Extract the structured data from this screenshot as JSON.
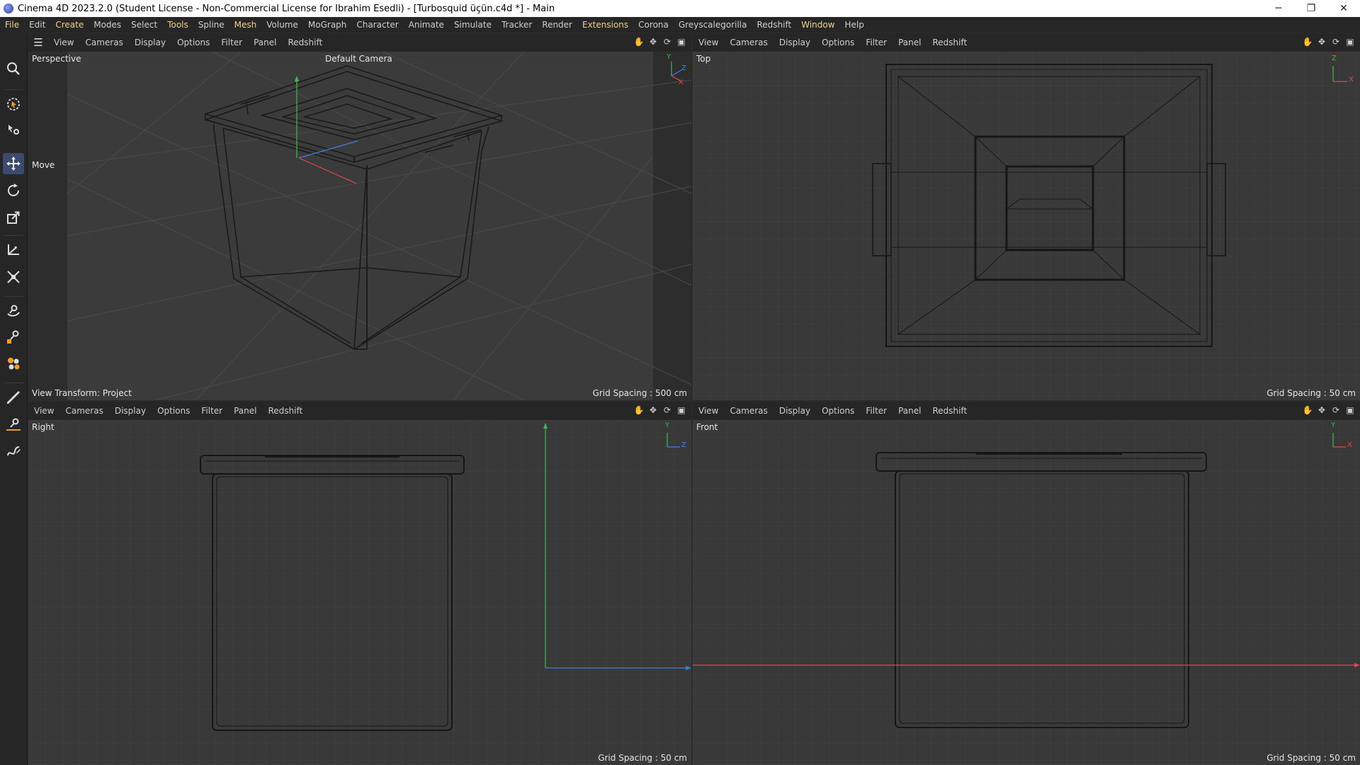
{
  "window": {
    "title": "Cinema 4D 2023.2.0 (Student License - Non-Commercial License for Ibrahim Esedli) - [Turbosquid üçün.c4d *] - Main",
    "minimize": "─",
    "maximize": "❐",
    "close": "✕"
  },
  "menu": [
    {
      "label": "File",
      "hl": true
    },
    {
      "label": "Edit"
    },
    {
      "label": "Create",
      "hl": true
    },
    {
      "label": "Modes"
    },
    {
      "label": "Select"
    },
    {
      "label": "Tools",
      "hl": true
    },
    {
      "label": "Spline"
    },
    {
      "label": "Mesh",
      "hl": true
    },
    {
      "label": "Volume"
    },
    {
      "label": "MoGraph"
    },
    {
      "label": "Character"
    },
    {
      "label": "Animate"
    },
    {
      "label": "Simulate"
    },
    {
      "label": "Tracker"
    },
    {
      "label": "Render"
    },
    {
      "label": "Extensions",
      "hl": true
    },
    {
      "label": "Corona"
    },
    {
      "label": "Greyscalegorilla"
    },
    {
      "label": "Redshift"
    },
    {
      "label": "Window",
      "hl": true
    },
    {
      "label": "Help"
    }
  ],
  "viewport_menu": [
    "View",
    "Cameras",
    "Display",
    "Options",
    "Filter",
    "Panel",
    "Redshift"
  ],
  "nav_icons": [
    "hand-icon",
    "move-cross-icon",
    "rotate-icon",
    "maximize-icon"
  ],
  "viewports": {
    "perspective": {
      "label": "Perspective",
      "camera": "Default Camera",
      "grid": "Grid Spacing : 500 cm",
      "transform": "View Transform: Project",
      "move": "Move"
    },
    "top": {
      "label": "Top",
      "grid": "Grid Spacing : 50 cm"
    },
    "right": {
      "label": "Right",
      "grid": "Grid Spacing : 50 cm"
    },
    "front": {
      "label": "Front",
      "grid": "Grid Spacing : 50 cm"
    }
  },
  "axis_letters": {
    "x": "X",
    "y": "Y",
    "z": "Z"
  },
  "colors": {
    "accent": "#3c4a6e",
    "axis_x": "#d94a4a",
    "axis_y": "#3dbb4d",
    "axis_z": "#3f7fe0",
    "menu_highlight": "#f0d28a"
  }
}
